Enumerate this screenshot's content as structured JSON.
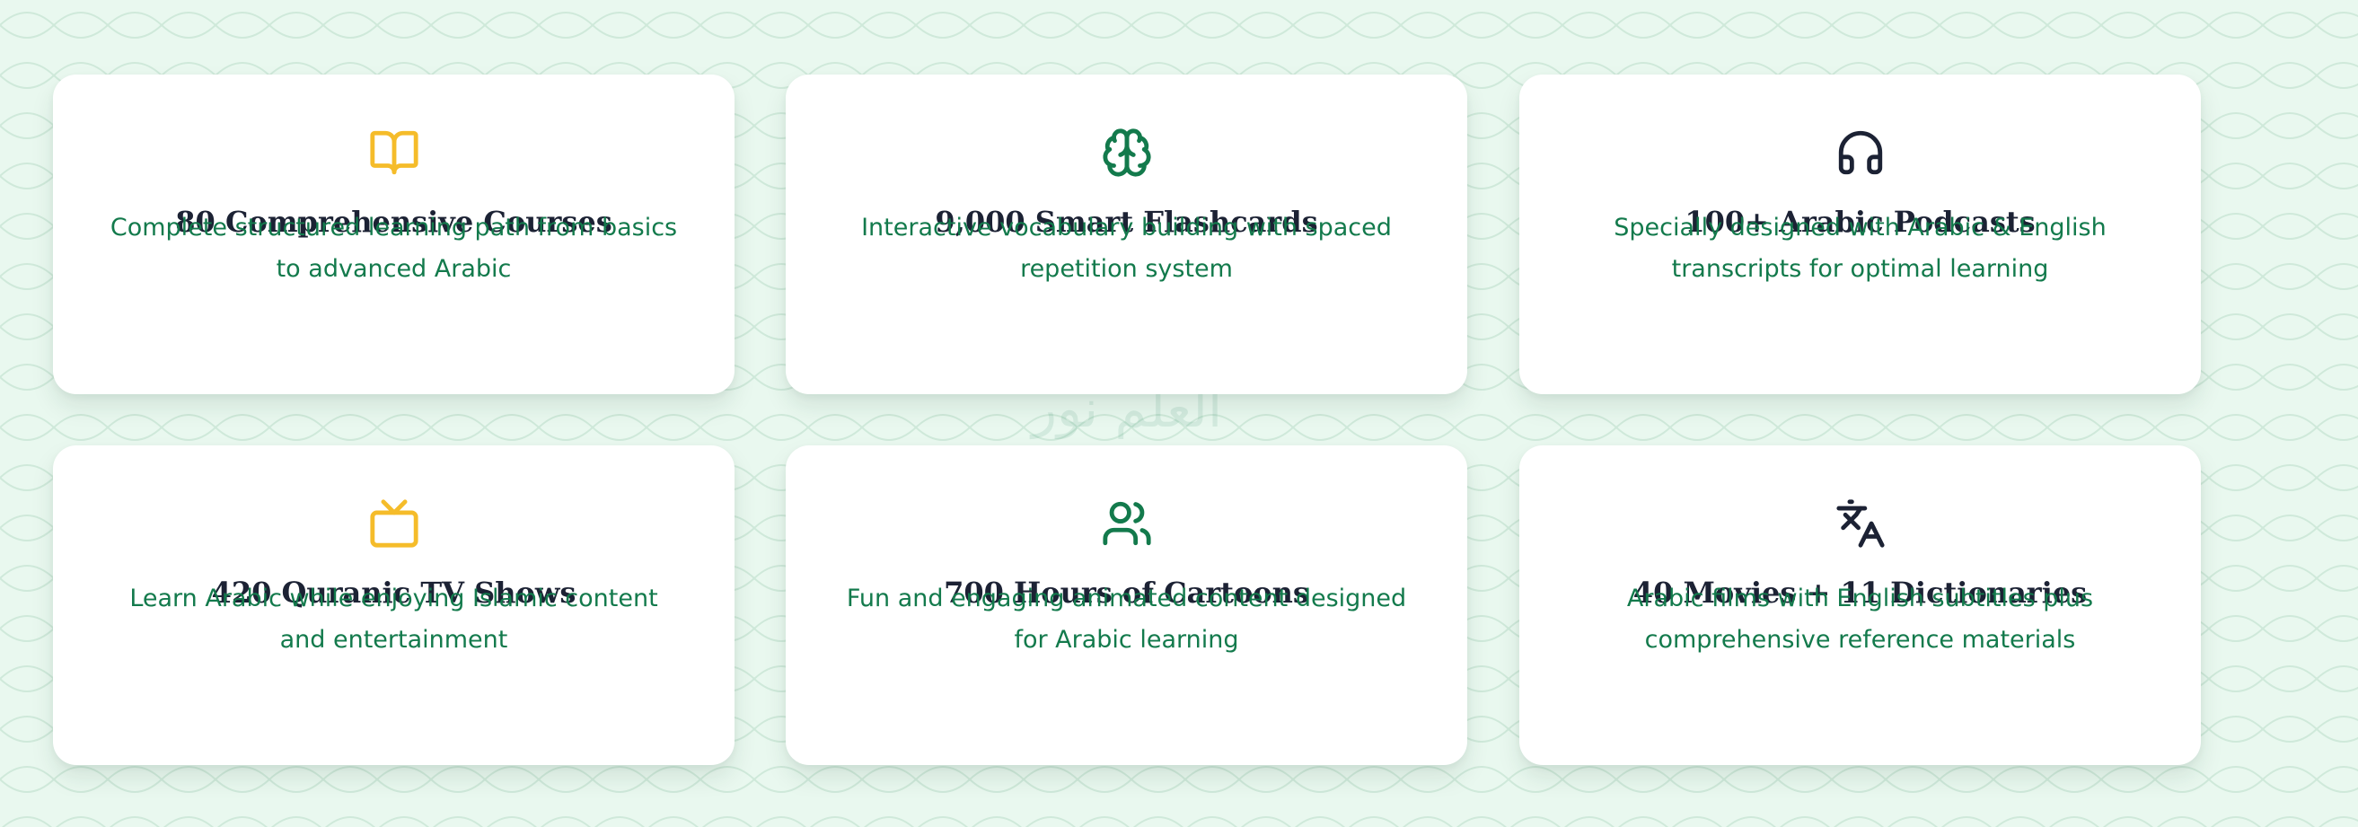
{
  "colors": {
    "background": "#e9f8ef",
    "card_background": "#ffffff",
    "title_color": "#1c2234",
    "description_color": "#137a4c",
    "accent_yellow": "#f5bc2a",
    "accent_green": "#137a4c",
    "accent_dark": "#1c2234"
  },
  "features": [
    {
      "icon": "book-open-icon",
      "icon_color": "#f5bc2a",
      "title": "80 Comprehensive Courses",
      "description": "Complete structured learning path from basics to advanced Arabic"
    },
    {
      "icon": "brain-icon",
      "icon_color": "#137a4c",
      "title": "9,000 Smart Flashcards",
      "description": "Interactive vocabulary building with spaced repetition system"
    },
    {
      "icon": "headphones-icon",
      "icon_color": "#1c2234",
      "title": "100+ Arabic Podcasts",
      "description": "Specially designed with Arabic & English transcripts for optimal learning"
    },
    {
      "icon": "tv-icon",
      "icon_color": "#f5bc2a",
      "title": "420 Quranic TV Shows",
      "description": "Learn Arabic while enjoying Islamic content and entertainment"
    },
    {
      "icon": "users-icon",
      "icon_color": "#137a4c",
      "title": "700 Hours of Cartoons",
      "description": "Fun and engaging animated content designed for Arabic learning"
    },
    {
      "icon": "translate-icon",
      "icon_color": "#1c2234",
      "title": "40 Movies + 11 Dictionaries",
      "description": "Arabic films with English subtitles plus comprehensive reference materials"
    }
  ],
  "watermark_text": "العلم نور"
}
